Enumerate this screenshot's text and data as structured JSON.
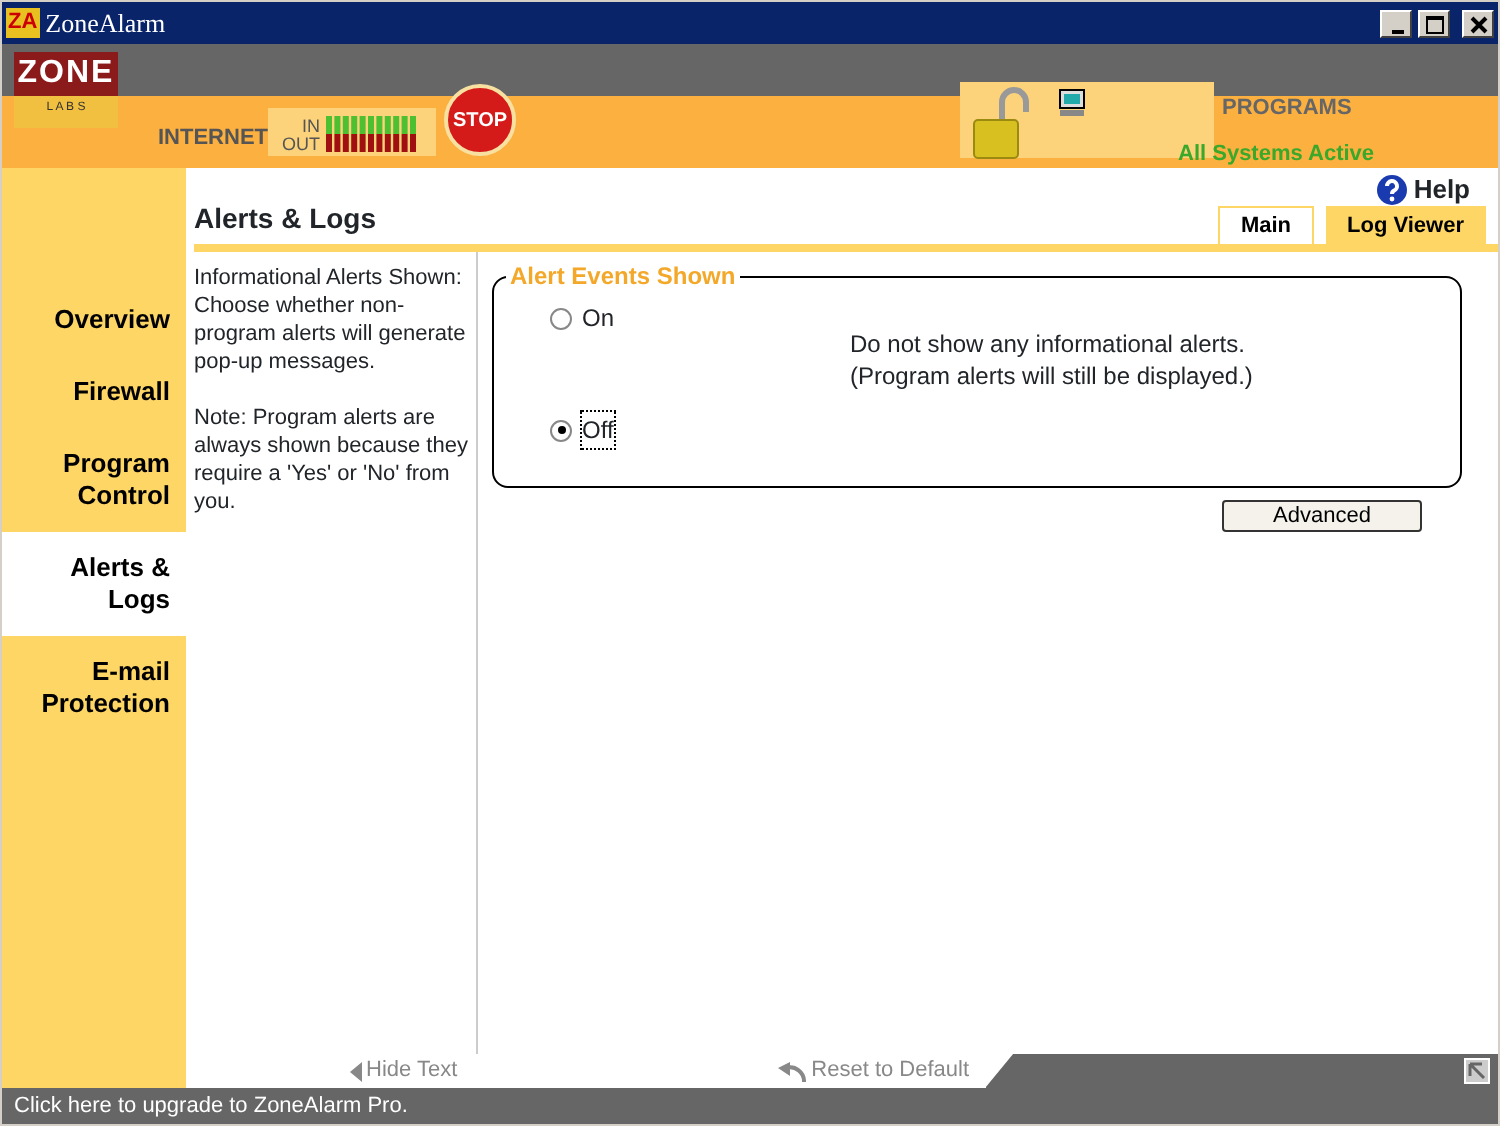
{
  "window": {
    "icon_text": "ZA",
    "title": "ZoneAlarm"
  },
  "header": {
    "logo_top": "ZONE",
    "logo_bottom": "L A B S",
    "internet_label": "INTERNET",
    "in_label": "IN",
    "out_label": "OUT",
    "stop_label": "STOP",
    "programs_label": "PROGRAMS",
    "status": "All Systems Active"
  },
  "help": "Help",
  "page_title": "Alerts & Logs",
  "tabs": [
    {
      "label": "Main",
      "selected": true
    },
    {
      "label": "Log Viewer",
      "selected": false
    }
  ],
  "sidebar": {
    "items": [
      {
        "label": "Overview",
        "selected": false
      },
      {
        "label": "Firewall",
        "selected": false
      },
      {
        "label": "Program Control",
        "selected": false
      },
      {
        "label": "Alerts & Logs",
        "selected": true
      },
      {
        "label": "E-mail Protection",
        "selected": false
      }
    ]
  },
  "description": [
    "Informational Alerts Shown: Choose whether non-program alerts will generate pop-up messages.",
    "Note: Program alerts are always shown because they require a 'Yes' or 'No' from you."
  ],
  "alert_events": {
    "legend": "Alert Events Shown",
    "options": [
      {
        "label": "On",
        "selected": false
      },
      {
        "label": "Off",
        "selected": true
      }
    ],
    "explanation": [
      "Do not show any informational alerts.",
      "(Program alerts will still be displayed.)"
    ]
  },
  "advanced_button": "Advanced",
  "hide_text": "Hide Text",
  "reset": "Reset to Default",
  "status_bar": "Click here to upgrade to ZoneAlarm Pro."
}
